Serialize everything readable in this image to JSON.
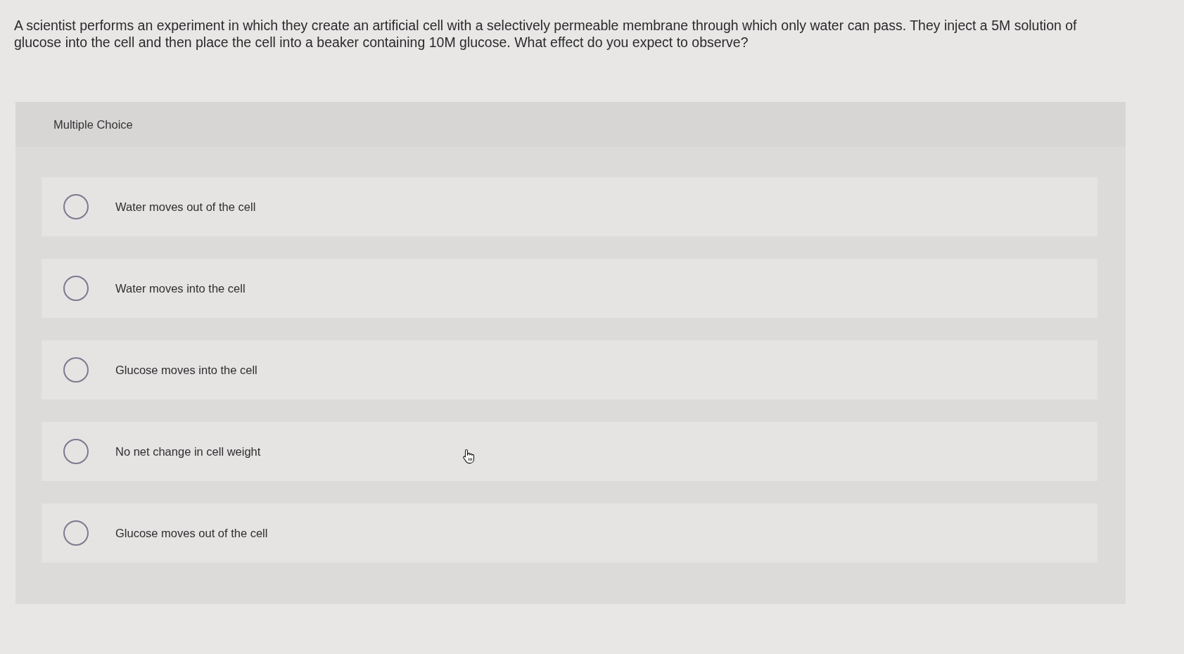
{
  "question": {
    "text": "A scientist performs an experiment in which they create an artificial cell with a selectively permeable membrane through which only water can pass. They inject a 5M solution of glucose into the cell and then place the cell into a beaker containing 10M glucose. What effect do you expect to observe?"
  },
  "panel": {
    "heading": "Multiple Choice"
  },
  "options": [
    {
      "label": "Water moves out of the cell",
      "selected": false
    },
    {
      "label": "Water moves into the cell",
      "selected": false
    },
    {
      "label": "Glucose moves into the cell",
      "selected": false
    },
    {
      "label": "No net change in cell weight",
      "selected": false
    },
    {
      "label": "Glucose moves out of the cell",
      "selected": false
    }
  ]
}
